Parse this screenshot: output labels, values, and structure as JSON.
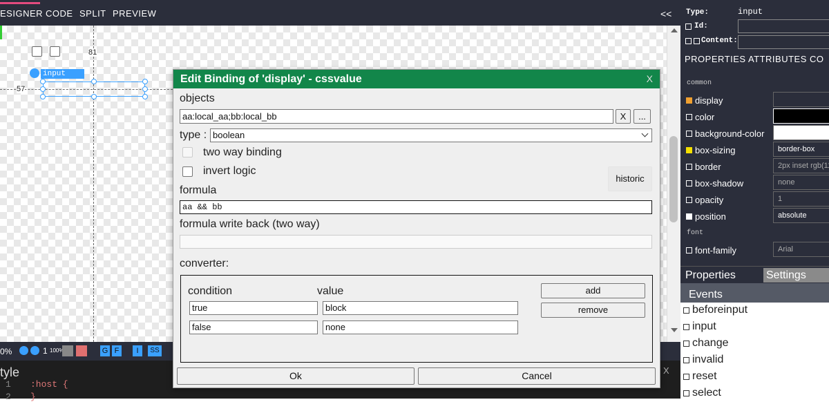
{
  "topbar": {
    "tabs": [
      "ESIGNER",
      "CODE",
      "SPLIT",
      "PREVIEW"
    ],
    "collapse": "<<"
  },
  "designer": {
    "element_label": "input",
    "measure_top": "81",
    "measure_left": "57"
  },
  "status": {
    "zoom": "0%",
    "zoom_value": "1",
    "zoom_pct": "100%",
    "btn_g": "G",
    "btn_f": "F",
    "btn_i": "I",
    "btn_ss": "SS"
  },
  "stylepanel": {
    "title": "tyle",
    "line1": "1",
    "line2": "2",
    "code1": ":host {",
    "code2": "}"
  },
  "rightpanel": {
    "type_label": "Type:",
    "type_value": "input",
    "id_label": "Id:",
    "content_label": "Content:",
    "tabs": "PROPERTIES  ATTRIBUTES  CO",
    "section_common": "common",
    "section_font": "font",
    "properties": [
      {
        "name": "display",
        "value": ""
      },
      {
        "name": "color",
        "value": ""
      },
      {
        "name": "background-color",
        "value": ""
      },
      {
        "name": "box-sizing",
        "value": "border-box"
      },
      {
        "name": "border",
        "value": "2px inset rgb(118"
      },
      {
        "name": "box-shadow",
        "value": "none"
      },
      {
        "name": "opacity",
        "value": "1"
      },
      {
        "name": "position",
        "value": "absolute"
      },
      {
        "name": "font-family",
        "value": "Arial"
      }
    ],
    "bottom_tab_properties": "Properties",
    "bottom_tab_settings": "Settings",
    "events_title": "Events",
    "events": [
      "beforeinput",
      "input",
      "change",
      "invalid",
      "reset",
      "select"
    ]
  },
  "dialog": {
    "title": "Edit Binding of 'display' - cssvalue",
    "close": "X",
    "objects_label": "objects",
    "objects_value": "aa:local_aa;bb:local_bb",
    "objects_x": "X",
    "objects_more": "...",
    "type_label": "type :",
    "type_value": "boolean",
    "two_way_label": "two way binding",
    "invert_label": "invert logic",
    "historic": "historic",
    "formula_label": "formula",
    "formula_value": "aa && bb",
    "writeback_label": "formula write back (two way)",
    "converter_label": "converter:",
    "condition_header": "condition",
    "value_header": "value",
    "add": "add",
    "remove": "remove",
    "rows": [
      {
        "condition": "true",
        "value": "block"
      },
      {
        "condition": "false",
        "value": "none"
      }
    ],
    "ok": "Ok",
    "cancel": "Cancel"
  },
  "colors": {
    "title_bar": "#12864a",
    "toolbar": "#2b2e3b",
    "accent": "#e54b7f",
    "selection": "#3aa0ff"
  }
}
